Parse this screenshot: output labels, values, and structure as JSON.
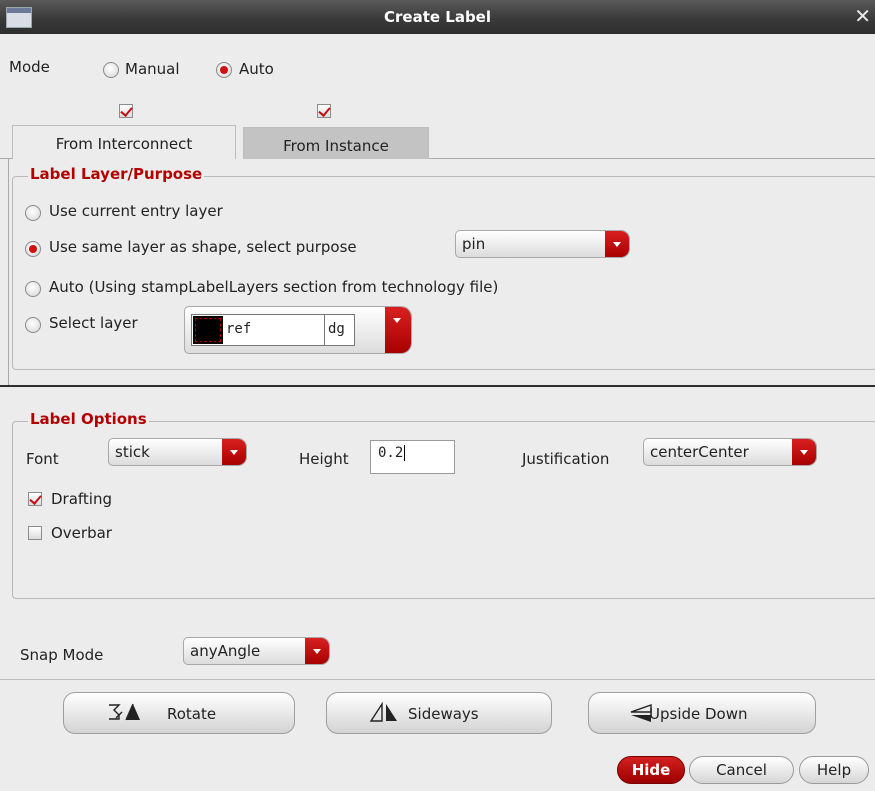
{
  "window": {
    "title": "Create Label"
  },
  "mode": {
    "label": "Mode",
    "options": [
      "Manual",
      "Auto"
    ],
    "selected": "Auto"
  },
  "tabs": [
    {
      "label": "From Interconnect",
      "checked": true,
      "active": true
    },
    {
      "label": "From Instance",
      "checked": true,
      "active": false
    }
  ],
  "layer_purpose": {
    "legend": "Label Layer/Purpose",
    "options": [
      "Use current entry layer",
      "Use same layer as shape, select purpose",
      "Auto (Using stampLabelLayers section from technology file)",
      "Select layer"
    ],
    "selected_index": 1,
    "purpose_value": "pin",
    "layer": {
      "name": "ref",
      "purpose": "dg",
      "swatch_color": "#000000"
    }
  },
  "label_options": {
    "legend": "Label Options",
    "font_label": "Font",
    "font_value": "stick",
    "height_label": "Height",
    "height_value": "0.2",
    "justification_label": "Justification",
    "justification_value": "centerCenter",
    "drafting": {
      "label": "Drafting",
      "checked": true
    },
    "overbar": {
      "label": "Overbar",
      "checked": false
    }
  },
  "snap": {
    "label": "Snap Mode",
    "value": "anyAngle"
  },
  "actions": {
    "rotate": "Rotate",
    "sideways": "Sideways",
    "upside_down": "Upside Down"
  },
  "footer": {
    "hide": "Hide",
    "cancel": "Cancel",
    "help": "Help"
  },
  "colors": {
    "accent": "#c00000",
    "legend": "#b30000",
    "titlebar": "#3a3a3a"
  }
}
